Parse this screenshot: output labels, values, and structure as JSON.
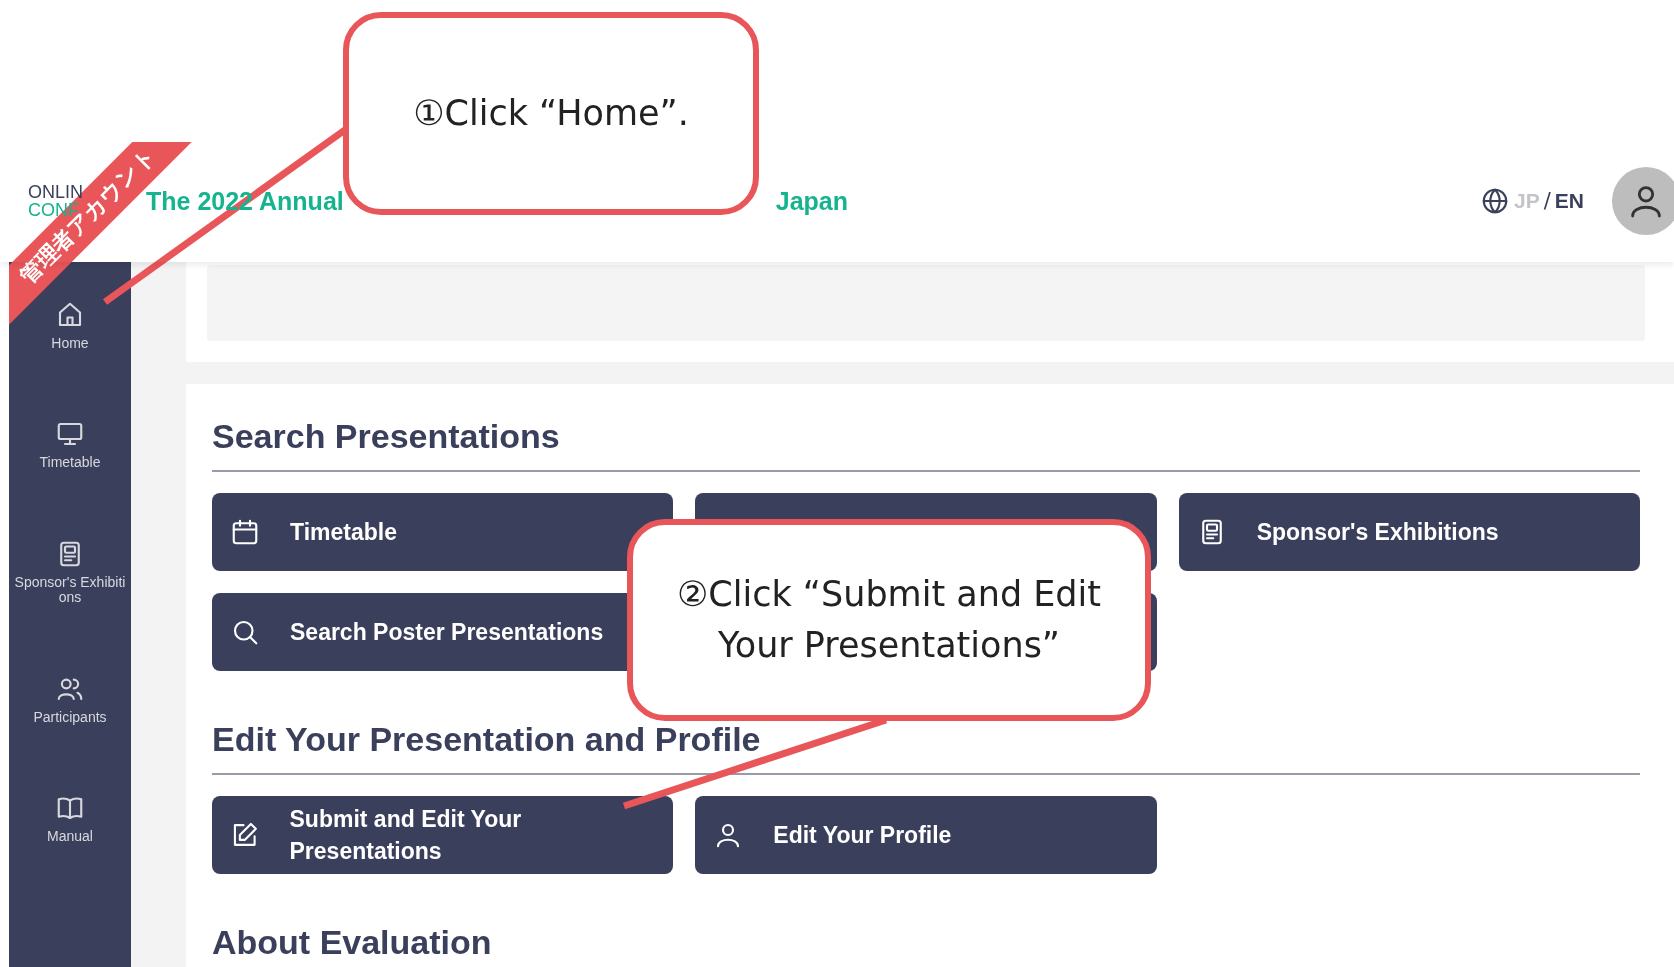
{
  "ribbon": "管理者アカウント",
  "header": {
    "logo_lines": [
      "ONLIN",
      "CONF"
    ],
    "title_visible_parts": [
      "The 2022 Annual",
      "Japan"
    ],
    "language": [
      {
        "label": "JP",
        "selected": false
      },
      {
        "label": "EN",
        "selected": true
      }
    ],
    "language_separator": "/"
  },
  "sidebar": {
    "items": [
      {
        "kind": "home",
        "label": "Home"
      },
      {
        "kind": "monitor",
        "label": "Timetable"
      },
      {
        "kind": "exhibit",
        "label": "Sponsor's Exhibitions"
      },
      {
        "kind": "people",
        "label": "Participants"
      },
      {
        "kind": "book",
        "label": "Manual"
      }
    ]
  },
  "sections": [
    {
      "title": "Search Presentations",
      "buttons": [
        {
          "kind": "calendar",
          "label": "Timetable"
        },
        {
          "kind": "hidden"
        },
        {
          "kind": "exhibit",
          "label": "Sponsor's Exhibitions"
        },
        {
          "kind": "search",
          "label": "Search Poster Presentations"
        },
        {
          "kind": "hidden"
        }
      ]
    },
    {
      "title": "Edit Your Presentation and Profile",
      "buttons": [
        {
          "kind": "edit",
          "label": "Submit and Edit Your Presentations"
        },
        {
          "kind": "person",
          "label": "Edit Your Profile"
        }
      ]
    },
    {
      "title": "About Evaluation"
    }
  ],
  "callouts": [
    {
      "text": "①Click “Home”."
    },
    {
      "text": "②Click “Submit and Edit Your Presentations”"
    }
  ]
}
